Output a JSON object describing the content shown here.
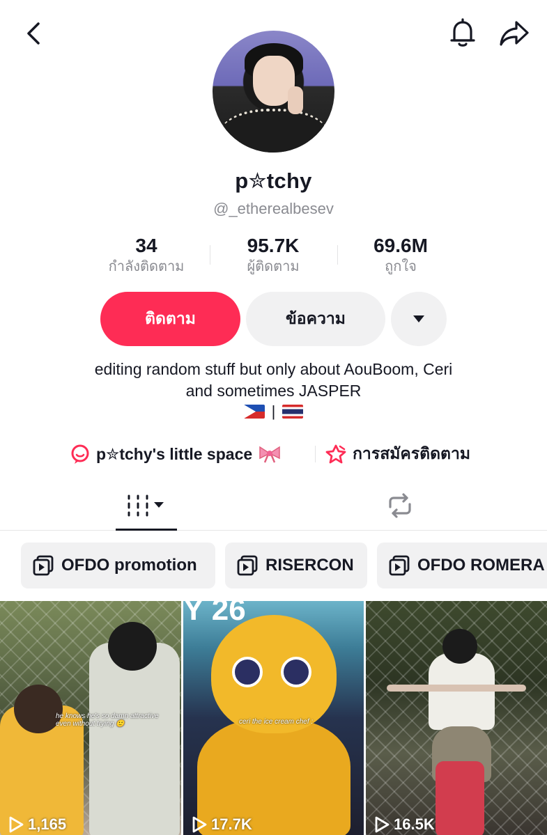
{
  "header": {
    "back_icon": "chevron-left-icon",
    "bell_icon": "bell-icon",
    "share_icon": "share-arrow-icon"
  },
  "profile": {
    "display_name": "p✮tchy",
    "handle": "@_etherealbesev",
    "stats": [
      {
        "value": "34",
        "label": "กำลังติดตาม"
      },
      {
        "value": "95.7K",
        "label": "ผู้ติดตาม"
      },
      {
        "value": "69.6M",
        "label": "ถูกใจ"
      }
    ],
    "actions": {
      "follow_label": "ติดตาม",
      "message_label": "ข้อความ",
      "more_icon": "caret-down-icon"
    },
    "bio_line1": "editing random stuff but only about AouBoom, Ceri",
    "bio_line2": "and sometimes JASPER",
    "bio_separator": "|",
    "links": [
      {
        "label": "p✮tchy's little space",
        "icon": "chat-bubble-icon"
      },
      {
        "label": "การสมัครติดตาม",
        "icon": "subscription-star-icon"
      }
    ]
  },
  "tabs": {
    "videos_icon": "grid-icon",
    "reposts_icon": "repost-icon"
  },
  "playlists": [
    {
      "label": "OFDO promotion"
    },
    {
      "label": "RISERCON"
    },
    {
      "label": "OFDO ROMERA"
    }
  ],
  "videos": [
    {
      "views": "1,165",
      "caption": "he knows he's so damn attractive even without trying 🙂"
    },
    {
      "views": "17.7K",
      "caption": "ceri the ice cream chef :",
      "overlay": "Y 26"
    },
    {
      "views": "16.5K"
    }
  ],
  "colors": {
    "accent": "#fe2c55",
    "secondary_button": "#f1f1f2",
    "text_primary": "#161823",
    "text_secondary": "#8a8b91"
  }
}
